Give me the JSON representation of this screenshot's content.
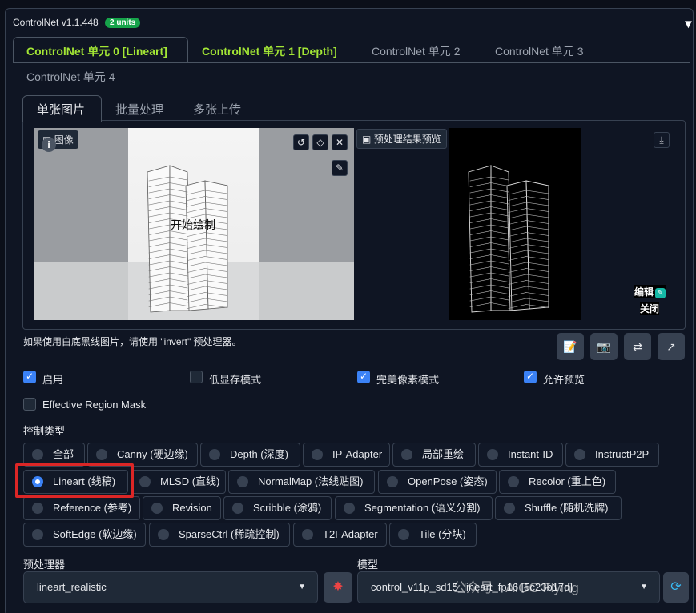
{
  "header": {
    "title": "ControlNet v1.1.448",
    "badge": "2 units",
    "collapse_icon": "triangle-down-icon"
  },
  "unit_tabs": [
    {
      "label": "ControlNet 单元 0 [Lineart]"
    },
    {
      "label": "ControlNet 单元 1 [Depth]"
    },
    {
      "label": "ControlNet 单元 2"
    },
    {
      "label": "ControlNet 单元 3"
    },
    {
      "label": "ControlNet 单元 4"
    }
  ],
  "image_tabs": [
    {
      "label": "单张图片"
    },
    {
      "label": "批量处理"
    },
    {
      "label": "多张上传"
    }
  ],
  "image_panel": {
    "image_label": "图像",
    "draw_label": "开始绘制",
    "preview_label": "预处理结果预览",
    "edit_label": "编辑",
    "close_label": "关闭"
  },
  "hint": "如果使用白底黑线图片，请使用 \"invert\" 预处理器。",
  "options": {
    "enable": {
      "label": "启用",
      "checked": true
    },
    "lowvram": {
      "label": "低显存模式",
      "checked": false
    },
    "pixel_perfect": {
      "label": "完美像素模式",
      "checked": true
    },
    "allow_preview": {
      "label": "允许预览",
      "checked": true
    },
    "region_mask": {
      "label": "Effective Region Mask",
      "checked": false
    }
  },
  "control_type": {
    "label": "控制类型",
    "selected": "Lineart (线稿)",
    "items": [
      "全部",
      "Canny (硬边缘)",
      "Depth (深度)",
      "IP-Adapter",
      "局部重绘",
      "Instant-ID",
      "InstructP2P",
      "Lineart (线稿)",
      "MLSD (直线)",
      "NormalMap (法线贴图)",
      "OpenPose (姿态)",
      "Recolor (重上色)",
      "Reference (参考)",
      "Revision",
      "Scribble (涂鸦)",
      "Segmentation (语义分割)",
      "Shuffle (随机洗牌)",
      "SoftEdge (软边缘)",
      "SparseCtrl (稀疏控制)",
      "T2I-Adapter",
      "Tile (分块)"
    ]
  },
  "preprocessor": {
    "label": "预处理器",
    "value": "lineart_realistic"
  },
  "model": {
    "label": "模型",
    "value": "control_v11p_sd15_lineart_fp16 [5c23b17d]"
  },
  "watermark": "公众号 · AIGC Flying"
}
